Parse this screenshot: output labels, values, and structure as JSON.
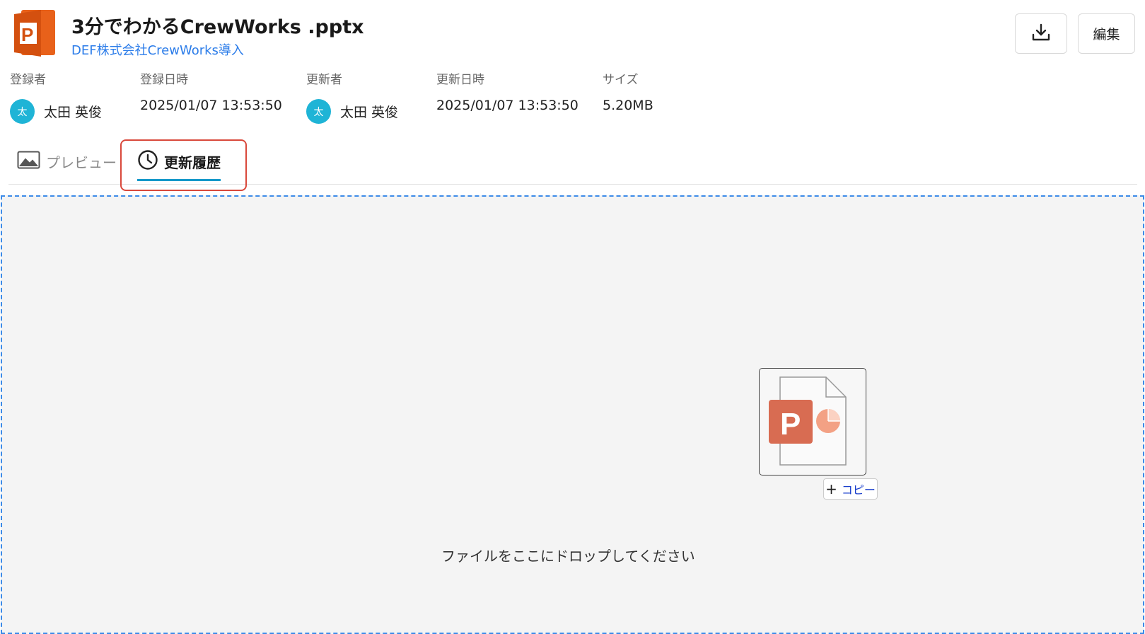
{
  "header": {
    "title": "3分でわかるCrewWorks .pptx",
    "subtitle": "DEF株式会社CrewWorks導入",
    "edit_label": "編集"
  },
  "meta": {
    "created_by_label": "登録者",
    "created_by_name": "太田 英俊",
    "created_by_avatar": "太",
    "created_at_label": "登録日時",
    "created_at_value": "2025/01/07 13:53:50",
    "updated_by_label": "更新者",
    "updated_by_name": "太田 英俊",
    "updated_by_avatar": "太",
    "updated_at_label": "更新日時",
    "updated_at_value": "2025/01/07 13:53:50",
    "size_label": "サイズ",
    "size_value": "5.20MB"
  },
  "tabs": [
    {
      "label": "プレビュー",
      "icon": "image-icon"
    },
    {
      "label": "更新履歴",
      "icon": "clock-icon"
    }
  ],
  "dropzone": {
    "message": "ファイルをここにドロップしてください",
    "copy_badge": "コピー"
  },
  "colors": {
    "accent": "#1598c9",
    "link": "#2b7ce9",
    "highlight": "#d9483b",
    "dropzone_border": "#3c8be8",
    "pptx_orange": "#e8611a"
  }
}
